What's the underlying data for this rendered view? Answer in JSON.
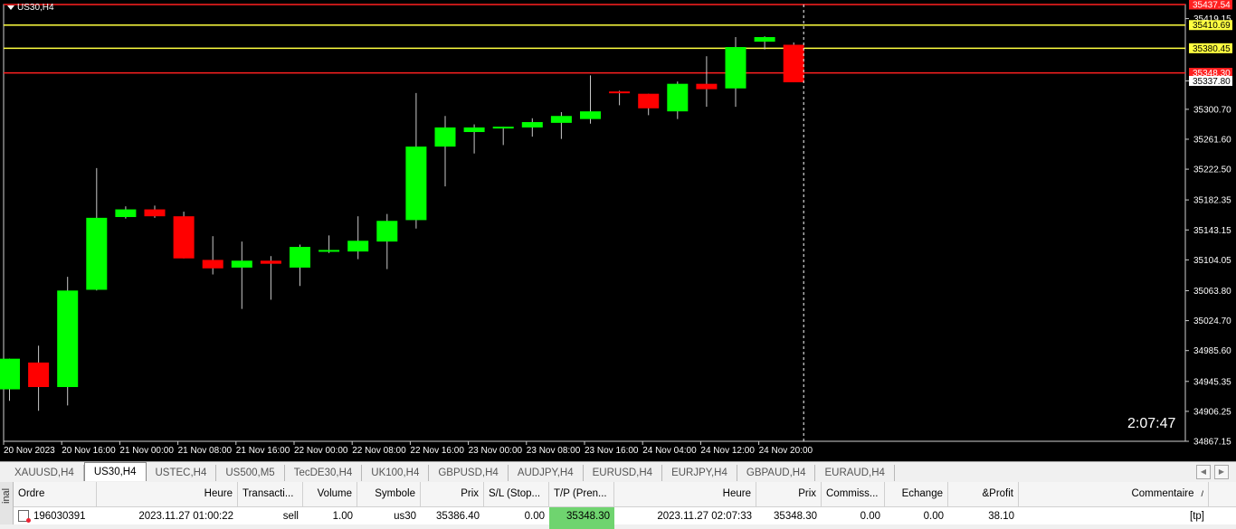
{
  "chart": {
    "symbol_title": "US30,H4",
    "timer": "2:07:47",
    "colors": {
      "bull": "#00ff00",
      "bear": "#ff0000",
      "wick": "#c8c8c8"
    },
    "price_range": [
      34867.15,
      35437.54
    ],
    "price_ticks": [
      "35419.15",
      "35337.80",
      "35300.70",
      "35261.60",
      "35222.50",
      "35182.35",
      "35143.15",
      "35104.05",
      "35063.80",
      "35024.70",
      "34985.60",
      "34945.35",
      "34906.25",
      "34867.15"
    ],
    "hlines": [
      {
        "price": 35437.54,
        "label": "35437.54",
        "color": "#ff2020",
        "tag_bg": "#ff2020",
        "tag_fg": "#ffffff"
      },
      {
        "price": 35410.69,
        "label": "35410.69",
        "color": "#ffff40",
        "tag_bg": "#ffff40",
        "tag_fg": "#000000"
      },
      {
        "price": 35380.45,
        "label": "35380.45",
        "color": "#ffff40",
        "tag_bg": "#ffff40",
        "tag_fg": "#000000"
      },
      {
        "price": 35348.3,
        "label": "35348.30",
        "color": "#ff2020",
        "tag_bg": "#ff2020",
        "tag_fg": "#ffffff"
      },
      {
        "price": 35337.8,
        "label": "35337.80",
        "color": "none",
        "tag_bg": "#ffffff",
        "tag_fg": "#000000"
      }
    ],
    "time_labels": [
      "20 Nov 2023",
      "20 Nov 16:00",
      "21 Nov 00:00",
      "21 Nov 08:00",
      "21 Nov 16:00",
      "22 Nov 00:00",
      "22 Nov 08:00",
      "22 Nov 16:00",
      "23 Nov 00:00",
      "23 Nov 08:00",
      "23 Nov 16:00",
      "24 Nov 04:00",
      "24 Nov 12:00",
      "24 Nov 20:00"
    ],
    "candles": [
      {
        "o": 34935,
        "h": 34975,
        "l": 34920,
        "c": 34975
      },
      {
        "o": 34970,
        "h": 34992,
        "l": 34907,
        "c": 34938
      },
      {
        "o": 34938,
        "h": 35082,
        "l": 34914,
        "c": 35064
      },
      {
        "o": 35065,
        "h": 35224,
        "l": 35064,
        "c": 35159
      },
      {
        "o": 35160,
        "h": 35174,
        "l": 35158,
        "c": 35170
      },
      {
        "o": 35170,
        "h": 35175,
        "l": 35159,
        "c": 35161
      },
      {
        "o": 35161,
        "h": 35167,
        "l": 35106,
        "c": 35106
      },
      {
        "o": 35104,
        "h": 35135,
        "l": 35085,
        "c": 35093
      },
      {
        "o": 35094,
        "h": 35128,
        "l": 35040,
        "c": 35103
      },
      {
        "o": 35103,
        "h": 35109,
        "l": 35052,
        "c": 35099
      },
      {
        "o": 35094,
        "h": 35124,
        "l": 35070,
        "c": 35121
      },
      {
        "o": 35117,
        "h": 35136,
        "l": 35113,
        "c": 35117
      },
      {
        "o": 35115,
        "h": 35161,
        "l": 35105,
        "c": 35129
      },
      {
        "o": 35128,
        "h": 35164,
        "l": 35092,
        "c": 35155
      },
      {
        "o": 35156,
        "h": 35322,
        "l": 35145,
        "c": 35252
      },
      {
        "o": 35252,
        "h": 35292,
        "l": 35200,
        "c": 35277
      },
      {
        "o": 35271,
        "h": 35281,
        "l": 35243,
        "c": 35277
      },
      {
        "o": 35277,
        "h": 35278,
        "l": 35254,
        "c": 35278
      },
      {
        "o": 35277,
        "h": 35289,
        "l": 35265,
        "c": 35284
      },
      {
        "o": 35283,
        "h": 35297,
        "l": 35262,
        "c": 35292
      },
      {
        "o": 35288,
        "h": 35345,
        "l": 35282,
        "c": 35298
      },
      {
        "o": 35324,
        "h": 35325,
        "l": 35306,
        "c": 35322
      },
      {
        "o": 35321,
        "h": 35321,
        "l": 35293,
        "c": 35302
      },
      {
        "o": 35298,
        "h": 35337,
        "l": 35288,
        "c": 35334
      },
      {
        "o": 35334,
        "h": 35370,
        "l": 35304,
        "c": 35327
      },
      {
        "o": 35328,
        "h": 35395,
        "l": 35304,
        "c": 35382
      },
      {
        "o": 35389,
        "h": 35396,
        "l": 35379,
        "c": 35395
      },
      {
        "o": 35385,
        "h": 35388,
        "l": 35336,
        "c": 35336
      }
    ]
  },
  "tabs": [
    {
      "label": "XAUUSD,H4",
      "active": false
    },
    {
      "label": "US30,H4",
      "active": true
    },
    {
      "label": "USTEC,H4",
      "active": false
    },
    {
      "label": "US500,M5",
      "active": false
    },
    {
      "label": "TecDE30,H4",
      "active": false
    },
    {
      "label": "UK100,H4",
      "active": false
    },
    {
      "label": "GBPUSD,H4",
      "active": false
    },
    {
      "label": "AUDJPY,H4",
      "active": false
    },
    {
      "label": "EURUSD,H4",
      "active": false
    },
    {
      "label": "EURJPY,H4",
      "active": false
    },
    {
      "label": "GBPAUD,H4",
      "active": false
    },
    {
      "label": "EURAUD,H4",
      "active": false
    }
  ],
  "terminal_label": "inal",
  "orders": {
    "columns": [
      {
        "label": "Ordre",
        "w": 92,
        "align": "l"
      },
      {
        "label": "Heure",
        "w": 156,
        "align": "r"
      },
      {
        "label": "Transacti...",
        "w": 72,
        "align": "l"
      },
      {
        "label": "Volume",
        "w": 60,
        "align": "r"
      },
      {
        "label": "Symbole",
        "w": 70,
        "align": "r"
      },
      {
        "label": "Prix",
        "w": 70,
        "align": "r"
      },
      {
        "label": "S/L (Stop...",
        "w": 72,
        "align": "l"
      },
      {
        "label": "T/P (Pren...",
        "w": 72,
        "align": "l"
      },
      {
        "label": "Heure",
        "w": 157,
        "align": "r"
      },
      {
        "label": "Prix",
        "w": 72,
        "align": "r"
      },
      {
        "label": "Commiss...",
        "w": 70,
        "align": "l"
      },
      {
        "label": "Echange",
        "w": 70,
        "align": "r"
      },
      {
        "label": "&Profit",
        "w": 78,
        "align": "r"
      },
      {
        "label": "Commentaire",
        "w": 210,
        "align": "r"
      }
    ],
    "sort_icon": "/",
    "rows": [
      [
        "196030391",
        "2023.11.27 01:00:22",
        "sell",
        "1.00",
        "us30",
        "35386.40",
        "0.00",
        "35348.30",
        "2023.11.27 02:07:33",
        "35348.30",
        "0.00",
        "0.00",
        "38.10",
        "[tp]"
      ]
    ]
  }
}
